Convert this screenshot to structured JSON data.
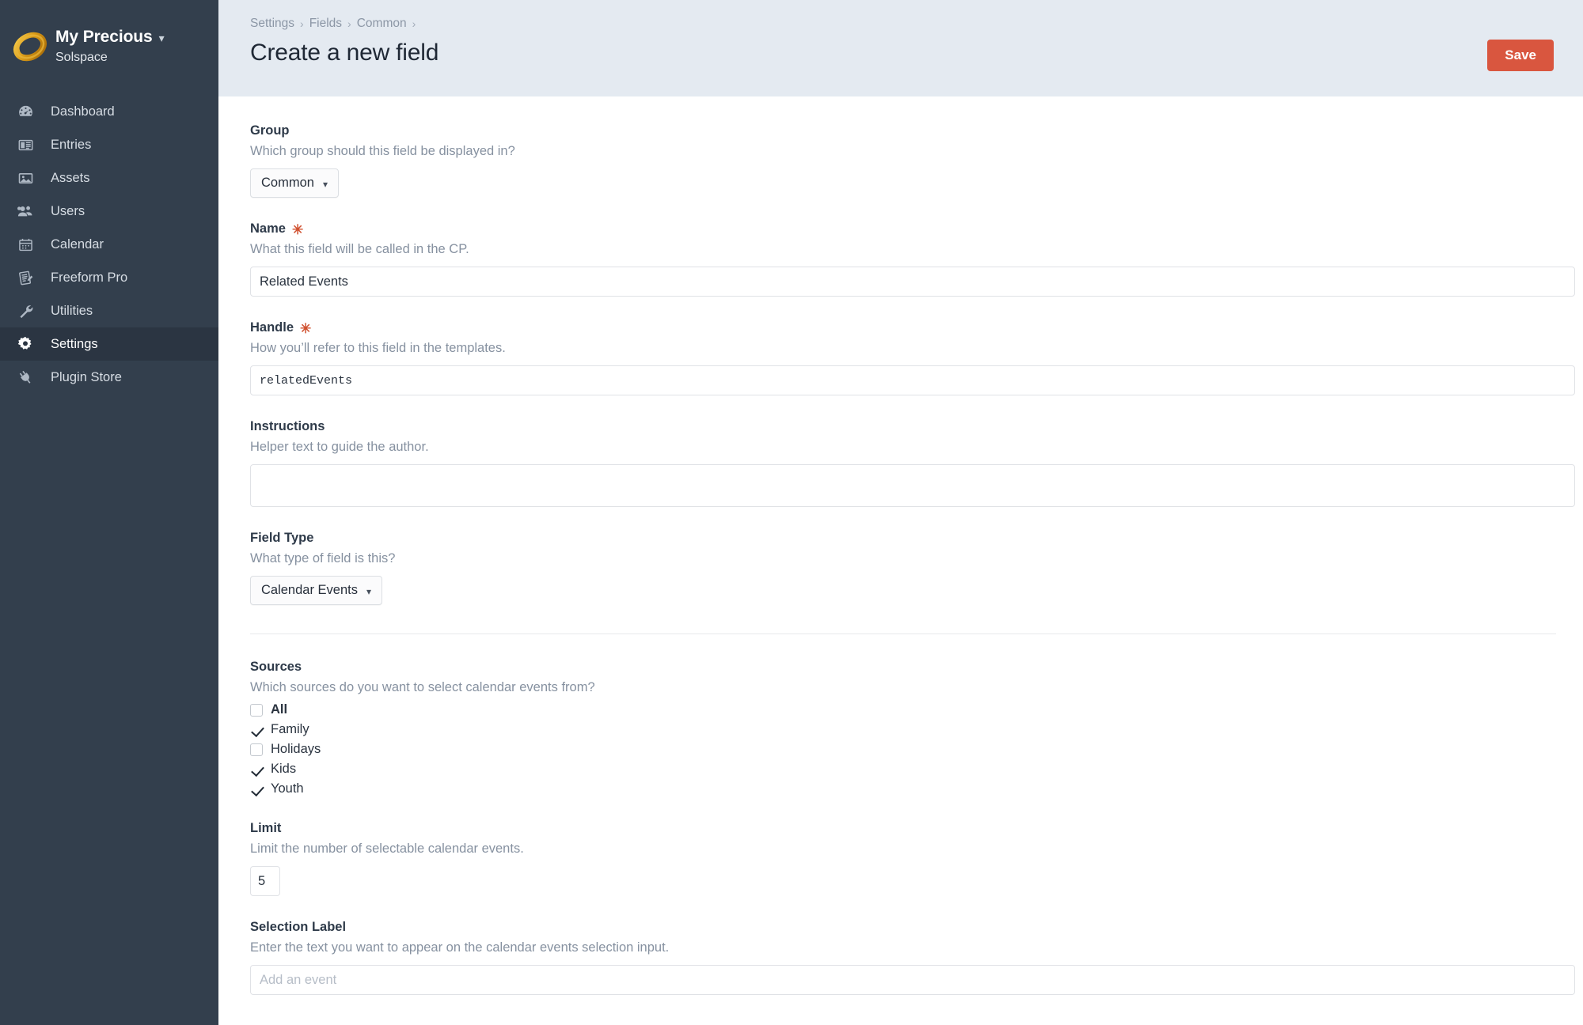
{
  "sidebar": {
    "brand": {
      "logo_icon": "gold-ring-icon",
      "title": "My Precious",
      "caret_icon": "chevron-down-icon",
      "subtitle": "Solspace"
    },
    "items": [
      {
        "label": "Dashboard",
        "icon": "gauge-icon",
        "active": false
      },
      {
        "label": "Entries",
        "icon": "newspaper-icon",
        "active": false
      },
      {
        "label": "Assets",
        "icon": "image-icon",
        "active": false
      },
      {
        "label": "Users",
        "icon": "users-icon",
        "active": false
      },
      {
        "label": "Calendar",
        "icon": "calendar-icon",
        "active": false
      },
      {
        "label": "Freeform Pro",
        "icon": "form-icon",
        "active": false
      },
      {
        "label": "Utilities",
        "icon": "wrench-icon",
        "active": false
      },
      {
        "label": "Settings",
        "icon": "gear-icon",
        "active": true
      },
      {
        "label": "Plugin Store",
        "icon": "plug-icon",
        "active": false
      }
    ]
  },
  "header": {
    "breadcrumb": [
      "Settings",
      "Fields",
      "Common"
    ],
    "breadcrumb_separator": "›",
    "title": "Create a new field",
    "save_label": "Save",
    "accent_color": "#d9563f",
    "band_color": "#e4eaf1"
  },
  "form": {
    "group": {
      "label": "Group",
      "instructions": "Which group should this field be displayed in?",
      "value": "Common",
      "caret_icon": "chevron-down-icon"
    },
    "name": {
      "label": "Name",
      "required_marker": "✳",
      "instructions": "What this field will be called in the CP.",
      "value": "Related Events"
    },
    "handle": {
      "label": "Handle",
      "required_marker": "✳",
      "instructions": "How you’ll refer to this field in the templates.",
      "value": "relatedEvents"
    },
    "instructions_field": {
      "label": "Instructions",
      "instructions": "Helper text to guide the author.",
      "value": ""
    },
    "field_type": {
      "label": "Field Type",
      "instructions": "What type of field is this?",
      "value": "Calendar Events",
      "caret_icon": "chevron-down-icon"
    },
    "sources": {
      "label": "Sources",
      "instructions": "Which sources do you want to select calendar events from?",
      "options": [
        {
          "label": "All",
          "checked": false,
          "bold": true
        },
        {
          "label": "Family",
          "checked": true,
          "bold": false
        },
        {
          "label": "Holidays",
          "checked": false,
          "bold": false
        },
        {
          "label": "Kids",
          "checked": true,
          "bold": false
        },
        {
          "label": "Youth",
          "checked": true,
          "bold": false
        }
      ]
    },
    "limit": {
      "label": "Limit",
      "instructions": "Limit the number of selectable calendar events.",
      "value": "5"
    },
    "selection_label": {
      "label": "Selection Label",
      "instructions": "Enter the text you want to appear on the calendar events selection input.",
      "value": "",
      "placeholder": "Add an event"
    }
  }
}
